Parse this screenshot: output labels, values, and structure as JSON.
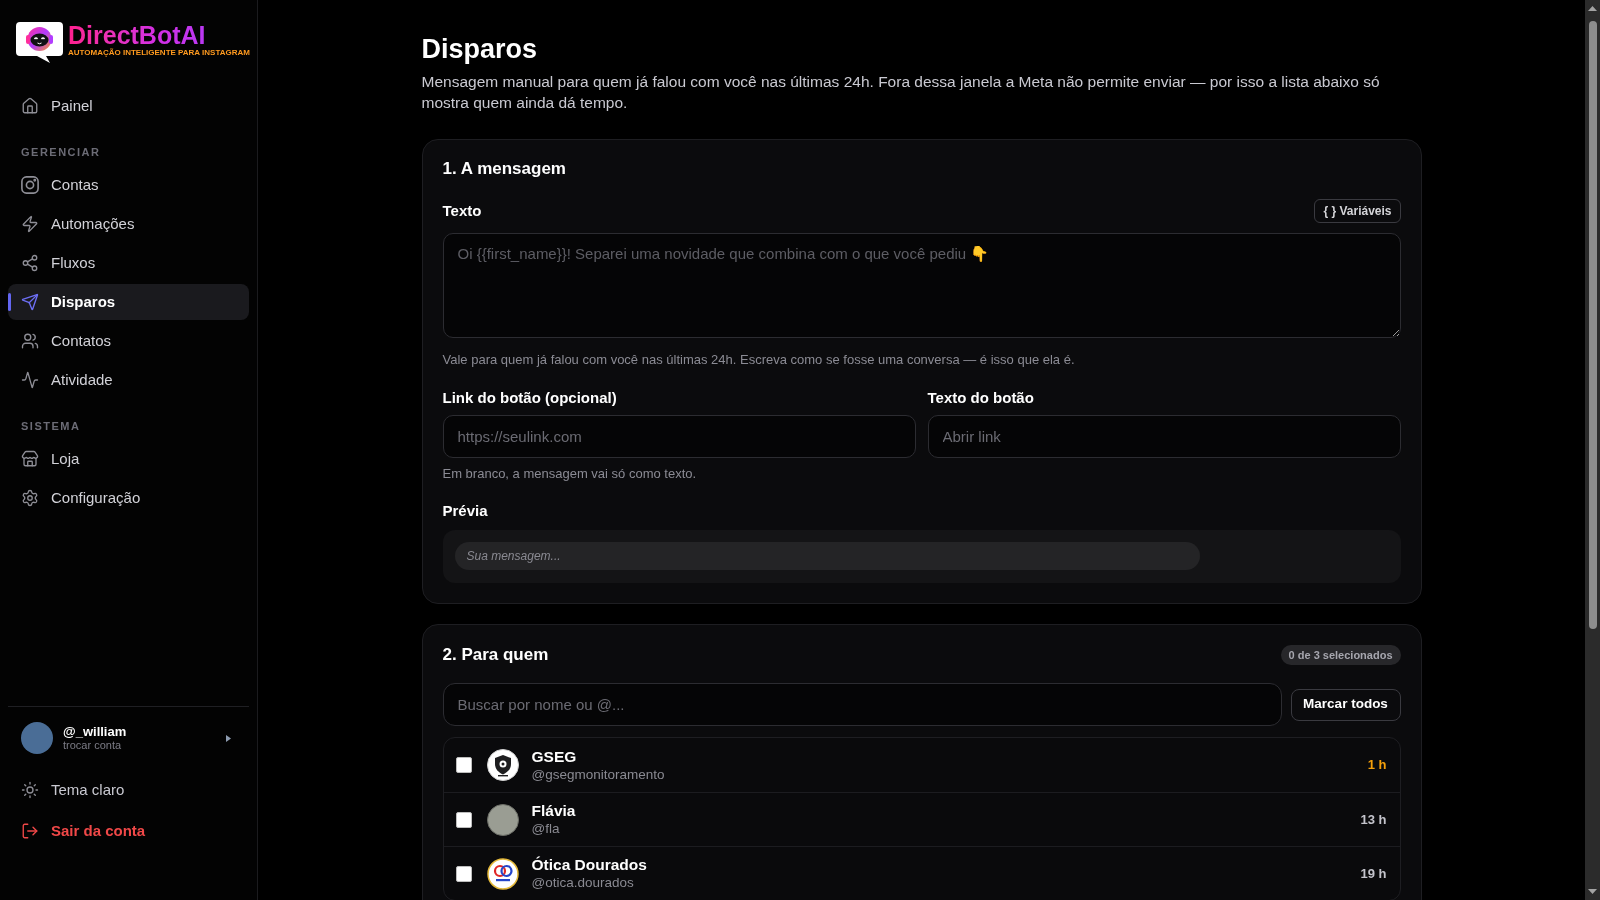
{
  "sidebar": {
    "logo": {
      "name": "DirectBotAI",
      "tagline": "AUTOMAÇÃO INTELIGENTE PARA INSTAGRAM"
    },
    "nav_groups": [
      {
        "items": [
          {
            "label": "Painel",
            "selected": false
          }
        ]
      },
      {
        "heading": "GERENCIAR",
        "items": [
          {
            "label": "Contas",
            "selected": false
          },
          {
            "label": "Automações",
            "selected": false
          },
          {
            "label": "Fluxos",
            "selected": false
          },
          {
            "label": "Disparos",
            "selected": true
          },
          {
            "label": "Contatos",
            "selected": false
          },
          {
            "label": "Atividade",
            "selected": false
          }
        ]
      },
      {
        "heading": "SISTEMA",
        "items": [
          {
            "label": "Loja",
            "selected": false
          },
          {
            "label": "Configuração",
            "selected": false
          }
        ]
      }
    ],
    "account": {
      "handle": "@_william",
      "subtitle": "trocar conta"
    },
    "actions": [
      {
        "kind": "theme",
        "label": "Tema claro"
      },
      {
        "kind": "logout",
        "label": "Sair da conta"
      }
    ]
  },
  "page": {
    "title": "Disparos",
    "description": "Mensagem manual para quem já falou com você nas últimas 24h. Fora dessa janela a Meta não permite enviar — por isso a lista abaixo só mostra quem ainda dá tempo."
  },
  "message_section": {
    "title": "1. A mensagem",
    "text_field": {
      "label": "Texto",
      "placeholder": "Oi {{first_name}}! Separei uma novidade que combina com o que você pediu 👇",
      "hint": "Vale para quem já falou com você nas últimas 24h. Escreva como se fosse uma conversa — é isso que ela é."
    },
    "variables_button": "{ } Variáveis",
    "link_field": {
      "label": "Link do botão (opcional)",
      "placeholder": "https://seulink.com"
    },
    "button_text_field": {
      "label": "Texto do botão",
      "placeholder": "Abrir link"
    },
    "link_hint": "Em branco, a mensagem vai só como texto.",
    "preview": {
      "label": "Prévia",
      "empty_text": "Sua mensagem..."
    }
  },
  "recipients_section": {
    "title": "2. Para quem",
    "selection_badge": "0 de 3 selecionados",
    "search": {
      "placeholder": "Buscar por nome ou @..."
    },
    "select_all_button": "Marcar todos",
    "contacts": [
      {
        "name": "GSEG",
        "handle": "@gsegmonitoramento",
        "time": "1 h",
        "recent": true,
        "checked": false
      },
      {
        "name": "Flávia",
        "handle": "@fla",
        "time": "13 h",
        "recent": false,
        "checked": false
      },
      {
        "name": "Ótica Dourados",
        "handle": "@otica.dourados",
        "time": "19 h",
        "recent": false,
        "checked": false
      }
    ]
  }
}
